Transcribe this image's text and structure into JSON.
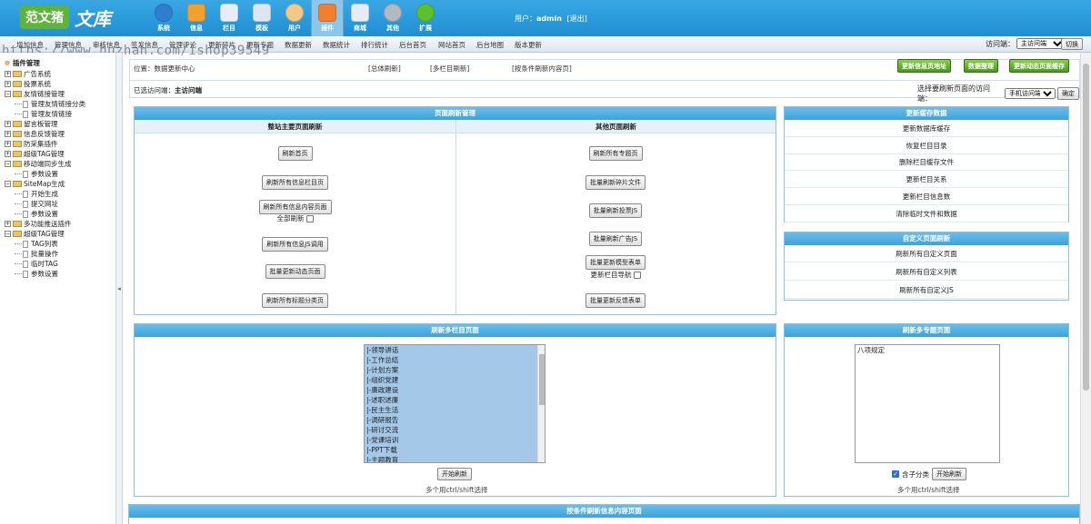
{
  "logo": {
    "badge": "范文猪",
    "script": "文库"
  },
  "topnav": [
    {
      "label": "系统",
      "icon": "globe-icon",
      "color": "#2f7fd0"
    },
    {
      "label": "信息",
      "icon": "edit-icon",
      "color": "#f0a030"
    },
    {
      "label": "栏目",
      "icon": "folder-icon",
      "color": "#e8eef7"
    },
    {
      "label": "模板",
      "icon": "template-icon",
      "color": "#dce6f0"
    },
    {
      "label": "用户",
      "icon": "user-icon",
      "color": "#f3c987"
    },
    {
      "label": "插件",
      "icon": "plugin-icon",
      "color": "#f08030"
    },
    {
      "label": "商城",
      "icon": "shop-icon",
      "color": "#e4ecf4"
    },
    {
      "label": "其他",
      "icon": "gear-icon",
      "color": "#b0b8c0"
    },
    {
      "label": "扩展",
      "icon": "plus-icon",
      "color": "#5bbf2e"
    }
  ],
  "user": {
    "prefix": "用户：",
    "name": "admin",
    "logout": "[退出]"
  },
  "subnav": [
    "增加信息",
    "管理信息",
    "审核信息",
    "签发信息",
    "管理评论",
    "更新碎片",
    "更新专题",
    "数据更新",
    "数据统计",
    "排行统计",
    "后台首页",
    "网站首页",
    "后台地图",
    "版本更新"
  ],
  "jump": {
    "label": "访问端：",
    "value": "主访问端",
    "switch": "切换"
  },
  "watermark": "https://www.huzhan.com/ishop39549",
  "sidebar": {
    "title": "插件管理",
    "nodes": [
      {
        "label": "广告系统",
        "type": "folder",
        "level": 0
      },
      {
        "label": "投票系统",
        "type": "folder",
        "level": 0
      },
      {
        "label": "友情链接管理",
        "type": "folder-open",
        "level": 0
      },
      {
        "label": "管理友情链接分类",
        "type": "doc",
        "level": 1
      },
      {
        "label": "管理友情链接",
        "type": "doc",
        "level": 1
      },
      {
        "label": "留言板管理",
        "type": "folder",
        "level": 0
      },
      {
        "label": "信息反馈管理",
        "type": "folder",
        "level": 0
      },
      {
        "label": "防采集插件",
        "type": "folder",
        "level": 0
      },
      {
        "label": "超级TAG管理",
        "type": "folder",
        "level": 0
      },
      {
        "label": "移动端同步生成",
        "type": "folder-open",
        "level": 0
      },
      {
        "label": "参数设置",
        "type": "doc",
        "level": 1
      },
      {
        "label": "SiteMap生成",
        "type": "folder-open",
        "level": 0
      },
      {
        "label": "开始生成",
        "type": "doc",
        "level": 1
      },
      {
        "label": "提交网址",
        "type": "doc",
        "level": 1
      },
      {
        "label": "参数设置",
        "type": "doc",
        "level": 1
      },
      {
        "label": "多功能推送插件",
        "type": "folder",
        "level": 0
      },
      {
        "label": "超级TAG管理",
        "type": "folder-open",
        "level": 0
      },
      {
        "label": "TAG列表",
        "type": "doc",
        "level": 1
      },
      {
        "label": "批量操作",
        "type": "doc",
        "level": 1
      },
      {
        "label": "临时TAG",
        "type": "doc",
        "level": 1
      },
      {
        "label": "参数设置",
        "type": "doc",
        "level": 1
      }
    ]
  },
  "position": {
    "text": "位置：数据更新中心",
    "link1": "[总体刷新]",
    "link2": "[多栏目刷新]",
    "link3": "[按条件刷新内容页]"
  },
  "green_buttons": [
    "更新信息页地址",
    "数据整理",
    "更新动态页面缓存"
  ],
  "current_terminal": {
    "label": "已选访问端：",
    "value": "主访问端"
  },
  "select_terminal": {
    "label": "选择要刷新页面的访问端：",
    "value": "手机访问端",
    "ok": "确定"
  },
  "refresh_panel": {
    "title": "页面刷新管理",
    "left_title": "整站主要页面刷新",
    "right_title": "其他页面刷新",
    "left_buttons": [
      "刷新首页",
      "刷新所有信息栏目页",
      "刷新所有信息内容页面",
      "刷新所有信息JS调用",
      "批量更新动态页面",
      "刷新所有标题分类页"
    ],
    "full_refresh": "全部刷新",
    "right_buttons": [
      "刷新所有专题页",
      "批量刷新碎片文件",
      "批量刷新投票JS",
      "批量刷新广告JS",
      "批量更新模型表单",
      "批量更新反馈表单"
    ],
    "update_nav": "更新栏目导航"
  },
  "cache_panel": {
    "title": "更新缓存数据",
    "links": [
      "更新数据库缓存",
      "恢复栏目目录",
      "删除栏目缓存文件",
      "更新栏目关系",
      "更新栏目信息数",
      "清除临时文件和数据"
    ]
  },
  "custom_panel": {
    "title": "自定义页面刷新",
    "links": [
      "刷新所有自定义页面",
      "刷新所有自定义列表",
      "刷新所有自定义JS"
    ]
  },
  "multi_col_panel": {
    "title": "刷新多栏目页面",
    "options": [
      "|-领导讲话",
      "|-工作总结",
      "|-计划方案",
      "|-组织党建",
      "|-廉政建设",
      "|-述职述廉",
      "|-民主生活",
      "|-调研报告",
      "|-研讨交流",
      "|-党课培训",
      "|-PPT下载",
      "|-主题教育"
    ],
    "button": "开始刷新",
    "hint": "多个用ctrl/shift选择"
  },
  "multi_topic_panel": {
    "title": "刷新多专题页面",
    "options": [
      "八项规定"
    ],
    "include_sub": "含子分类",
    "button": "开始刷新",
    "hint": "多个用ctrl/shift选择"
  },
  "bottom_panel": {
    "title": "按条件刷新信息内容页面"
  }
}
